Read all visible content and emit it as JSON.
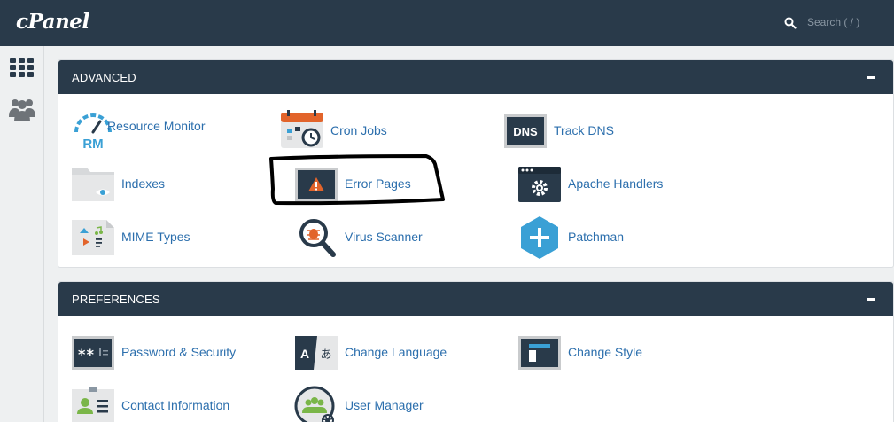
{
  "header": {
    "logo": "cPanel",
    "search_placeholder": "Search ( / )"
  },
  "sidebar": {
    "items": [
      {
        "icon": "grid-icon"
      },
      {
        "icon": "users-icon"
      }
    ]
  },
  "sections": [
    {
      "title": "ADVANCED",
      "items": [
        {
          "label": "Resource Monitor",
          "icon": "resource-monitor-icon"
        },
        {
          "label": "Cron Jobs",
          "icon": "cron-jobs-icon"
        },
        {
          "label": "Track DNS",
          "icon": "dns-icon",
          "icon_text": "DNS"
        },
        {
          "label": "Indexes",
          "icon": "indexes-icon"
        },
        {
          "label": "Error Pages",
          "icon": "error-pages-icon"
        },
        {
          "label": "Apache Handlers",
          "icon": "apache-handlers-icon"
        },
        {
          "label": "MIME Types",
          "icon": "mime-types-icon"
        },
        {
          "label": "Virus Scanner",
          "icon": "virus-scanner-icon"
        },
        {
          "label": "Patchman",
          "icon": "patchman-icon"
        }
      ]
    },
    {
      "title": "PREFERENCES",
      "items": [
        {
          "label": "Password & Security",
          "icon": "password-icon"
        },
        {
          "label": "Change Language",
          "icon": "change-language-icon"
        },
        {
          "label": "Change Style",
          "icon": "change-style-icon"
        },
        {
          "label": "Contact Information",
          "icon": "contact-info-icon"
        },
        {
          "label": "User Manager",
          "icon": "user-manager-icon"
        }
      ]
    }
  ],
  "icon_text": {
    "resource_monitor": "RM",
    "dns": "DNS",
    "password": "**",
    "language_a": "A",
    "language_b": "あ"
  },
  "colors": {
    "header_bg": "#293a4a",
    "link": "#2c6fad",
    "accent_orange": "#e2642b",
    "accent_blue": "#3aa0d5"
  }
}
